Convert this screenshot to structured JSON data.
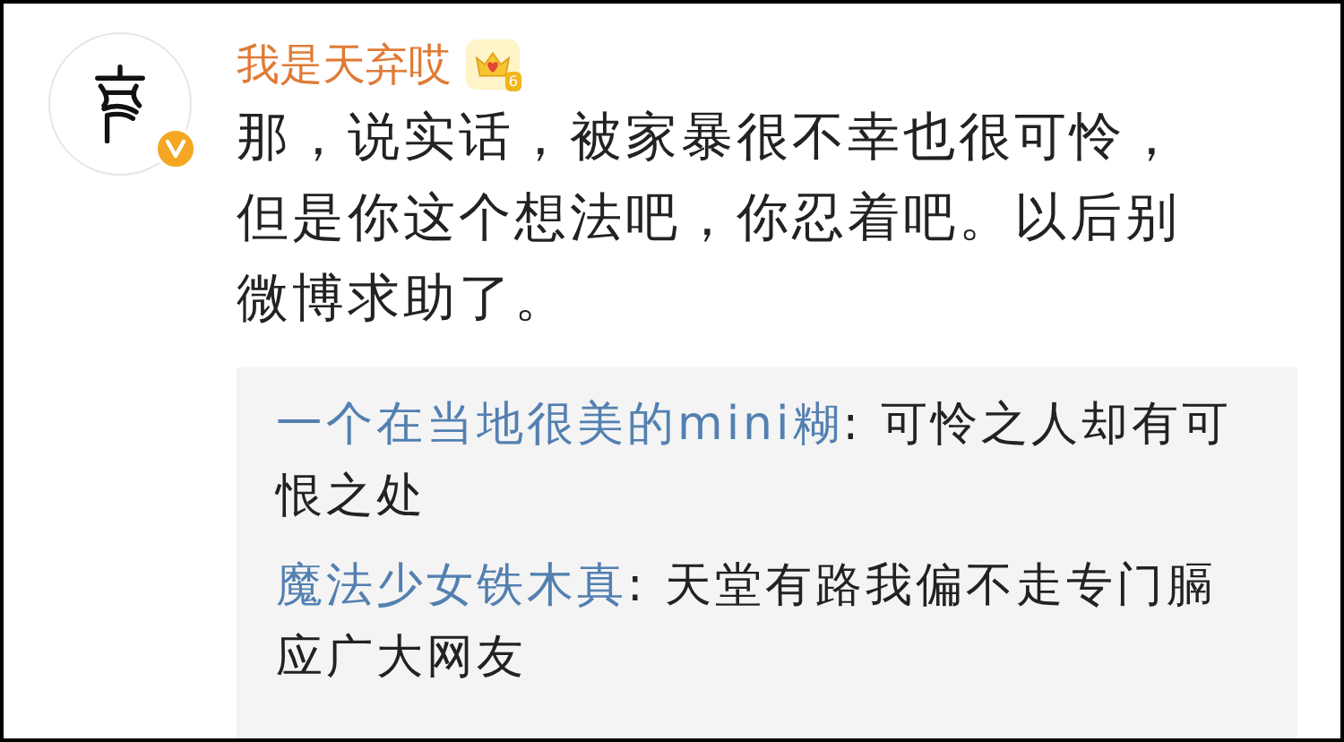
{
  "comment": {
    "username": "我是天弃哎",
    "badge_level": "6",
    "verified": true,
    "text": "那，说实话，被家暴很不幸也很可怜，但是你这个想法吧，你忍着吧。以后别微博求助了。"
  },
  "replies": [
    {
      "author": "一个在当地很美的mini糊",
      "separator": ": ",
      "text": "可怜之人却有可恨之处"
    },
    {
      "author": "魔法少女铁木真",
      "separator": ": ",
      "text": "天堂有路我偏不走专门膈应广大网友"
    }
  ]
}
